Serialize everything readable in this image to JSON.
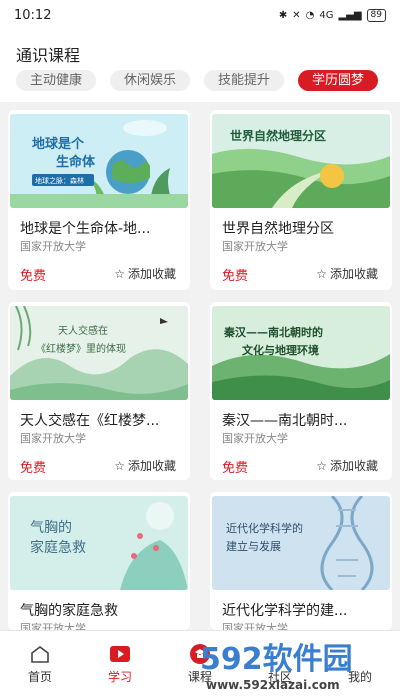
{
  "status": {
    "time": "10:12",
    "network": "4G",
    "battery": "89"
  },
  "section_title": "通识课程",
  "tabs": [
    {
      "label": "主动健康"
    },
    {
      "label": "休闲娱乐"
    },
    {
      "label": "技能提升"
    },
    {
      "label": "学历圆梦"
    }
  ],
  "courses": [
    {
      "title": "地球是个生命体-地...",
      "thumb_line1": "地球是个",
      "thumb_line2": "生命体",
      "thumb_tag": "地球之脉：森林",
      "provider": "国家开放大学",
      "price": "免费",
      "fav": "添加收藏"
    },
    {
      "title": "世界自然地理分区",
      "thumb_line1": "世界自然地理分区",
      "provider": "国家开放大学",
      "price": "免费",
      "fav": "添加收藏"
    },
    {
      "title": "天人交感在《红楼梦...",
      "thumb_line1": "天人交感在",
      "thumb_line2": "《红楼梦》里的体现",
      "provider": "国家开放大学",
      "price": "免费",
      "fav": "添加收藏"
    },
    {
      "title": "秦汉——南北朝时...",
      "thumb_line1": "秦汉——南北朝时的",
      "thumb_line2": "文化与地理环境",
      "provider": "国家开放大学",
      "price": "免费",
      "fav": "添加收藏"
    },
    {
      "title": "气胸的家庭急救",
      "thumb_line1": "气胸的",
      "thumb_line2": "家庭急救",
      "provider": "国家开放大学"
    },
    {
      "title": "近代化学科学的建...",
      "thumb_line1": "近代化学科学的",
      "thumb_line2": "建立与发展",
      "provider": "国家开放大学"
    }
  ],
  "nav": [
    {
      "label": "首页"
    },
    {
      "label": "学习"
    },
    {
      "label": "课程"
    },
    {
      "label": "社区"
    },
    {
      "label": "我的"
    }
  ],
  "watermark": {
    "text": "592软件园",
    "url": "www.592xiazai.com"
  },
  "colors": {
    "accent": "#d91c23",
    "background": "#f2f2f2"
  }
}
